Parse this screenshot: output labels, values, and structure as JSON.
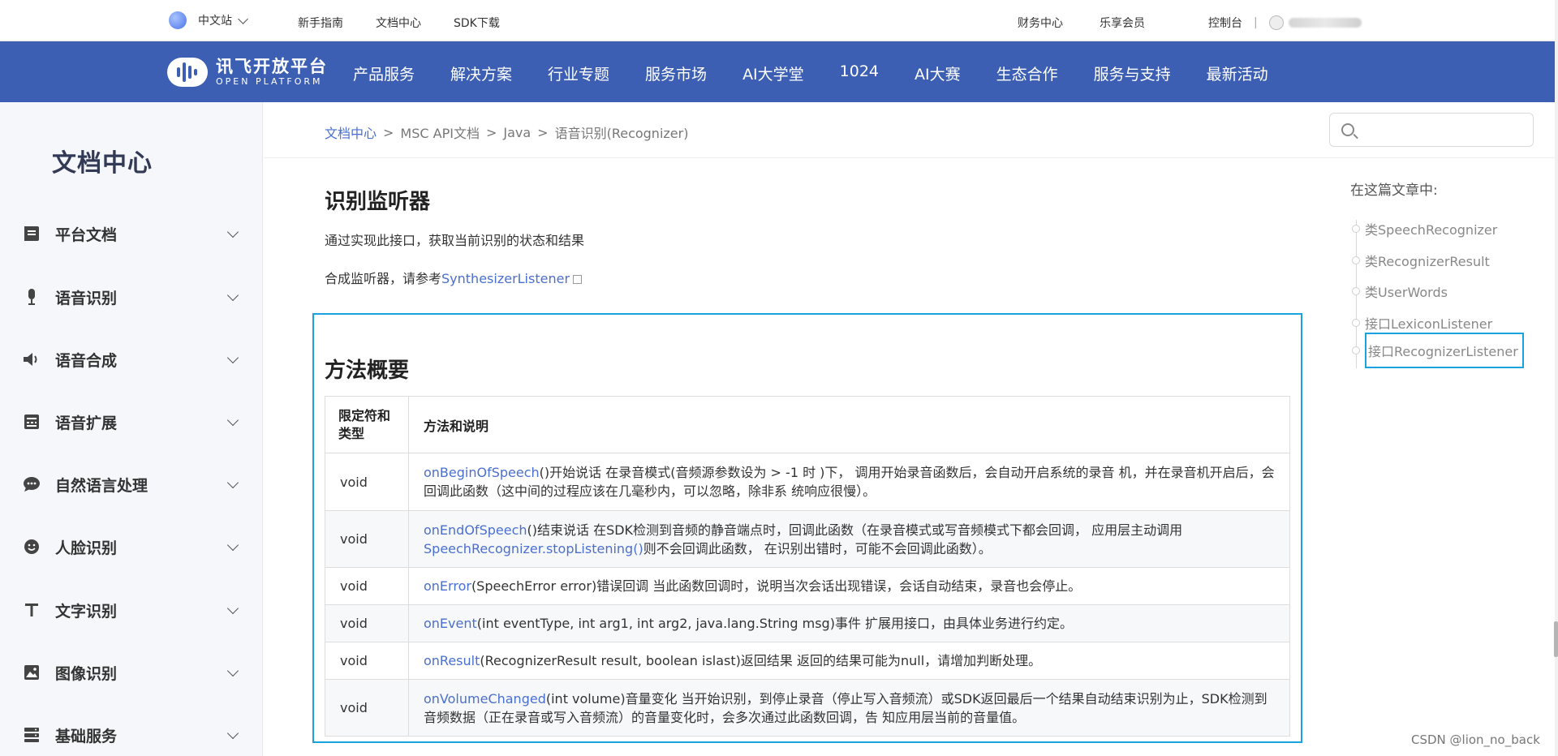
{
  "topbar": {
    "language": "中文站",
    "links": [
      "新手指南",
      "文档中心",
      "SDK下载"
    ],
    "finance": "财务中心",
    "member": "乐享会员",
    "console": "控制台",
    "separator": "|"
  },
  "nav": {
    "logo_cn": "讯飞开放平台",
    "logo_en": "OPEN PLATFORM",
    "items": [
      "产品服务",
      "解决方案",
      "行业专题",
      "服务市场",
      "AI大学堂",
      "1024",
      "AI大赛",
      "生态合作",
      "服务与支持",
      "最新活动"
    ]
  },
  "sidebar": {
    "title": "文档中心",
    "items": [
      {
        "label": "平台文档",
        "icon": "document-icon"
      },
      {
        "label": "语音识别",
        "icon": "microphone-icon"
      },
      {
        "label": "语音合成",
        "icon": "speaker-icon"
      },
      {
        "label": "语音扩展",
        "icon": "keyboard-icon"
      },
      {
        "label": "自然语言处理",
        "icon": "chat-icon"
      },
      {
        "label": "人脸识别",
        "icon": "face-icon"
      },
      {
        "label": "文字识别",
        "icon": "text-icon"
      },
      {
        "label": "图像识别",
        "icon": "image-icon"
      },
      {
        "label": "基础服务",
        "icon": "server-icon"
      }
    ]
  },
  "breadcrumb": {
    "home": "文档中心",
    "sep": ">",
    "level2": "MSC API文档",
    "level3": "Java",
    "level4": "语音识别(Recognizer)"
  },
  "search": {
    "placeholder": ""
  },
  "article": {
    "heading": "识别监听器",
    "desc": "通过实现此接口，获取当前识别的状态和结果",
    "see_prefix": "合成监听器，请参考",
    "see_link": "SynthesizerListener",
    "summary_heading": "方法概要",
    "table": {
      "headers": [
        "限定符和类型",
        "方法和说明"
      ],
      "rows": [
        {
          "type": "void",
          "name": "onBeginOfSpeech",
          "desc": "()开始说话 在录音模式(音频源参数设为 > -1 时 )下， 调用开始录音函数后，会自动开启系统的录音 机，并在录音机开启后，会回调此函数（这中间的过程应该在几毫秒内，可以忽略，除非系 统响应很慢）。"
        },
        {
          "type": "void",
          "name": "onEndOfSpeech",
          "desc_a": "()结束说话 在SDK检测到音频的静音端点时，回调此函数（在录音模式或写音频模式下都会回调， 应用层主动调用",
          "link2": "SpeechRecognizer.stopListening()",
          "desc_b": "则不会回调此函数， 在识别出错时，可能不会回调此函数）。"
        },
        {
          "type": "void",
          "name": "onError",
          "desc": "(SpeechError error)错误回调 当此函数回调时，说明当次会话出现错误，会话自动结束，录音也会停止。"
        },
        {
          "type": "void",
          "name": "onEvent",
          "desc": "(int eventType, int arg1, int arg2, java.lang.String msg)事件 扩展用接口，由具体业务进行约定。"
        },
        {
          "type": "void",
          "name": "onResult",
          "desc": "(RecognizerResult result, boolean islast)返回结果 返回的结果可能为null，请增加判断处理。"
        },
        {
          "type": "void",
          "name": "onVolumeChanged",
          "desc": "(int volume)音量变化 当开始识别，到停止录音（停止写入音频流）或SDK返回最后一个结果自动结束识别为止，SDK检测到音频数据（正在录音或写入音频流）的音量变化时，会多次通过此函数回调，告 知应用层当前的音量值。"
        }
      ]
    }
  },
  "toc": {
    "title": "在这篇文章中:",
    "items": [
      "类SpeechRecognizer",
      "类RecognizerResult",
      "类UserWords",
      "接口LexiconListener",
      "接口RecognizerListener"
    ],
    "active_index": 4
  },
  "watermark": "CSDN @lion_no_back",
  "colors": {
    "nav_bg": "#3c5fb3",
    "link": "#4b6fd0",
    "highlight": "#1aa3de"
  }
}
